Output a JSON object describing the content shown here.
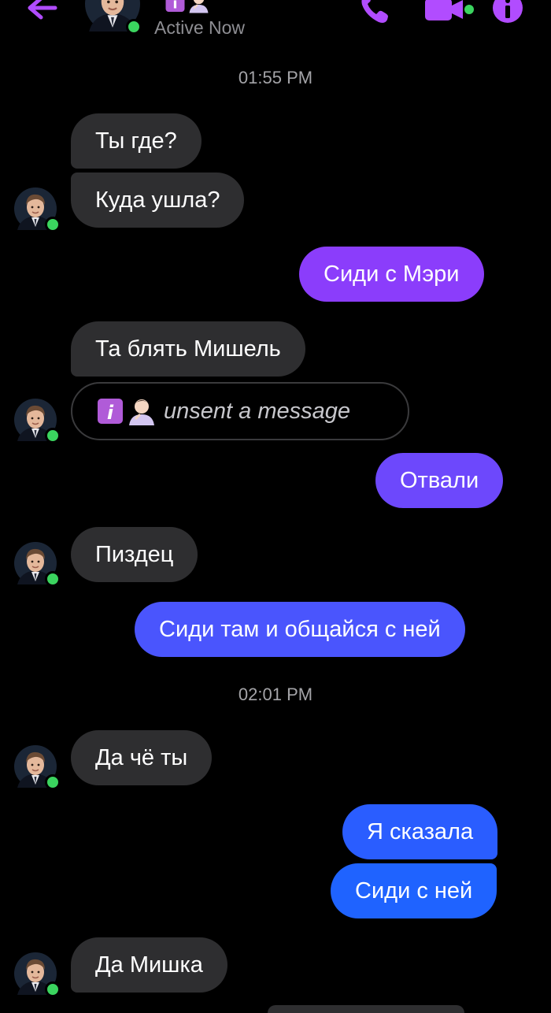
{
  "header": {
    "status": "Active Now",
    "icons": [
      "back-arrow-icon",
      "phone-icon",
      "video-camera-icon",
      "info-icon"
    ],
    "accent_color": "#b14cff",
    "online_color": "#3bd45f"
  },
  "timestamps": [
    "01:55 PM",
    "02:01 PM"
  ],
  "messages": [
    {
      "from": "them",
      "text": "Ты где?"
    },
    {
      "from": "them",
      "text": "Куда ушла?"
    },
    {
      "from": "me",
      "text": "Сиди с Мэри"
    },
    {
      "from": "them",
      "text": "Та блять Мишель"
    },
    {
      "from": "them",
      "text": "unsent a message"
    },
    {
      "from": "me",
      "text": "Отвали"
    },
    {
      "from": "them",
      "text": "Пиздец"
    },
    {
      "from": "me",
      "text": "Сиди там и общайся с ней"
    },
    {
      "from": "them",
      "text": "Да чё ты"
    },
    {
      "from": "me",
      "text": "Я сказала"
    },
    {
      "from": "me",
      "text": "Сиди с ней"
    },
    {
      "from": "them",
      "text": "Да Мишка"
    }
  ],
  "colors": {
    "incoming_bubble": "#2e2e30",
    "outgoing_top": "#8b3dfb",
    "outgoing_bottom": "#1f63ff"
  }
}
